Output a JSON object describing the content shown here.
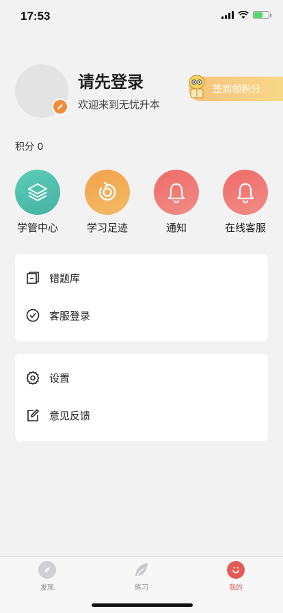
{
  "status_bar": {
    "time": "17:53"
  },
  "profile": {
    "title": "请先登录",
    "subtitle": "欢迎来到无忧升本",
    "checkin_label": "签到领积分"
  },
  "points": {
    "label": "积分 0"
  },
  "quick_actions": [
    {
      "label": "学管中心",
      "icon": "layers-icon",
      "color": "#4fc1ae"
    },
    {
      "label": "学习足迹",
      "icon": "history-icon",
      "color": "#f4a24a"
    },
    {
      "label": "通知",
      "icon": "bell-icon",
      "color": "#ee6a67"
    },
    {
      "label": "在线客服",
      "icon": "bell-icon",
      "color": "#ee6a67"
    }
  ],
  "menu_group_1": [
    {
      "label": "错题库",
      "icon": "book-icon"
    },
    {
      "label": "客服登录",
      "icon": "check-circle-icon"
    }
  ],
  "menu_group_2": [
    {
      "label": "设置",
      "icon": "gear-icon"
    },
    {
      "label": "意见反馈",
      "icon": "edit-icon"
    }
  ],
  "tabbar": [
    {
      "label": "发现",
      "icon": "compass-icon",
      "active": false
    },
    {
      "label": "练习",
      "icon": "feather-icon",
      "active": false
    },
    {
      "label": "我的",
      "icon": "user-icon",
      "active": true
    }
  ],
  "colors": {
    "accent": "#e35b55",
    "orange": "#f08c3a",
    "checkin": "#f6c27a"
  }
}
